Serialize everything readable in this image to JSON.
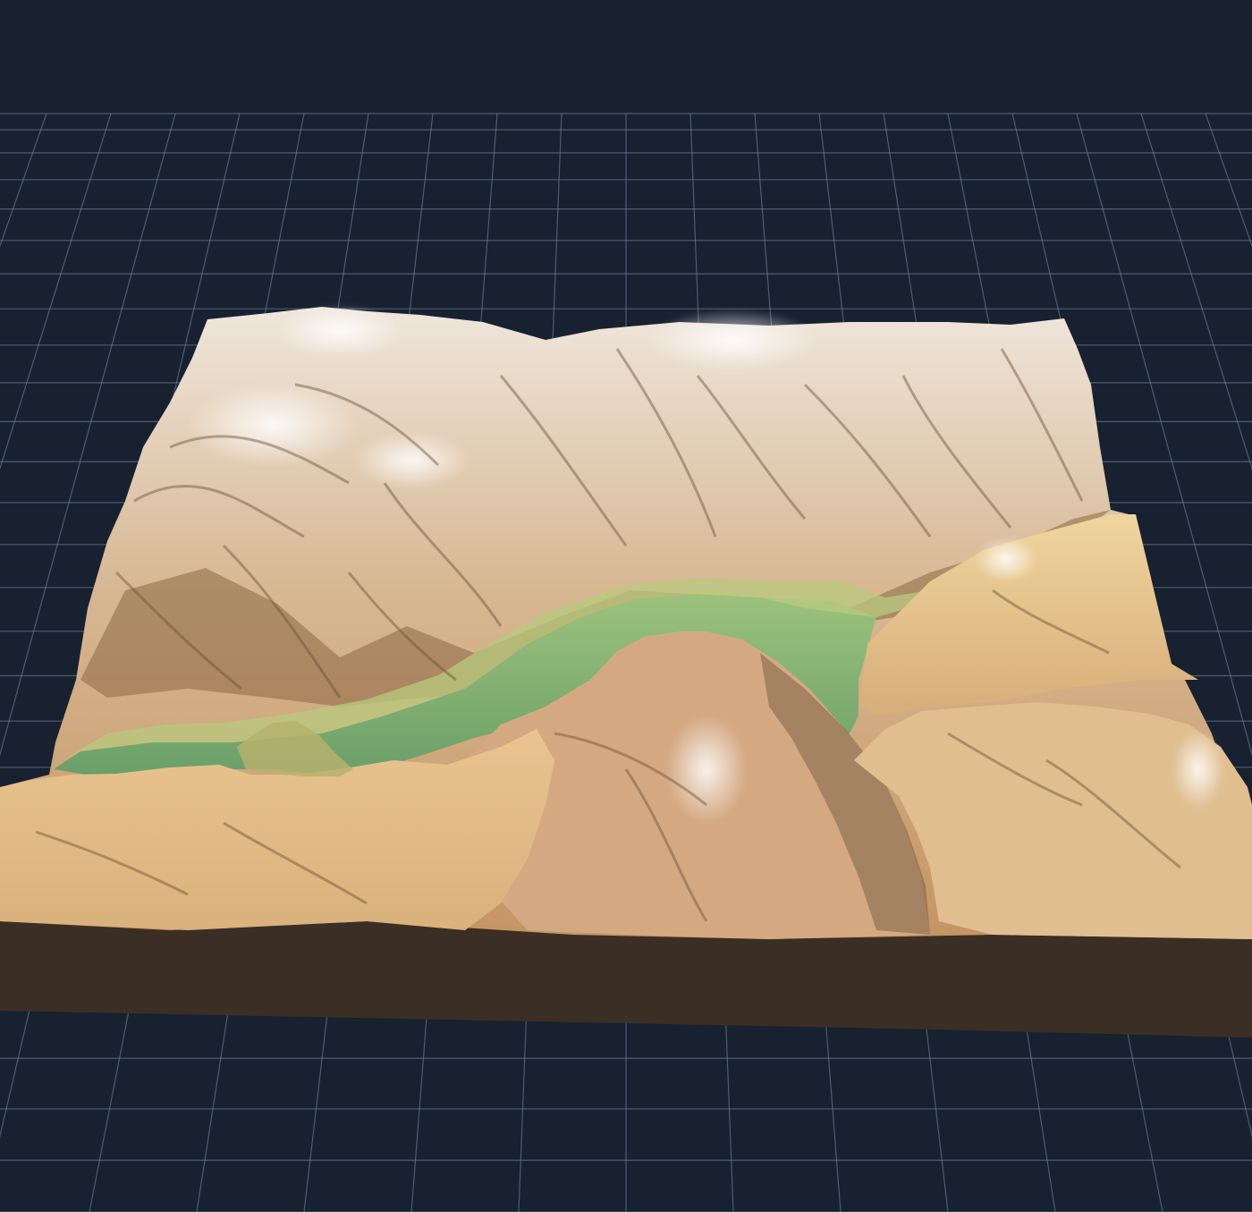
{
  "viewer": {
    "background_color": "#172130",
    "grid_color": "#6f8299",
    "ground_visible": true,
    "grid_visible": true
  },
  "terrain": {
    "base_color": "#3b2e24",
    "lowland_color": "#6fa26a",
    "valley_color": "#88b472",
    "midland_color": "#d8b47e",
    "highland_color": "#c69c78",
    "peak_color": "#f2eee8",
    "shadow_color": "#4b3a28",
    "colormap": "hypsometric",
    "lighting": "hillshade"
  }
}
